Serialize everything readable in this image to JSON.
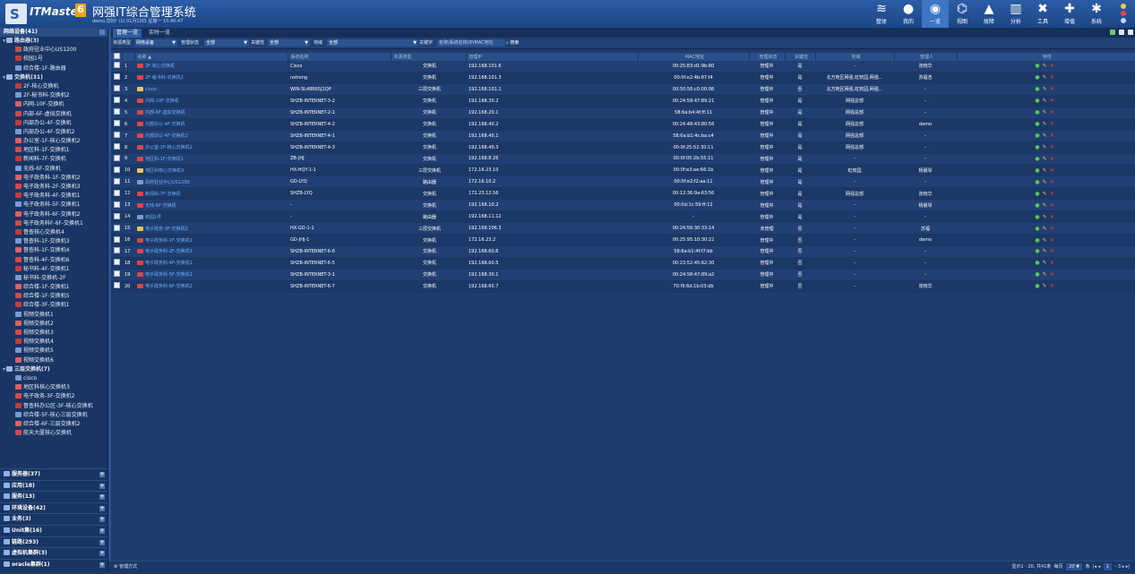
{
  "app": {
    "brand": "ITMaster",
    "brand_version": "6",
    "title": "网强IT综合管理系统",
    "user_line": "demo,您好! (1) 01月10日 星期一 15:40:47"
  },
  "nav": [
    {
      "label": "整体",
      "icon": "layers-icon",
      "glyph": "≋"
    },
    {
      "label": "我的",
      "icon": "user-icon",
      "glyph": "●"
    },
    {
      "label": "一览",
      "icon": "globe-icon",
      "glyph": "◉"
    },
    {
      "label": "视图",
      "icon": "topology-icon",
      "glyph": "⌬"
    },
    {
      "label": "故障",
      "icon": "alert-icon",
      "glyph": "▲"
    },
    {
      "label": "分析",
      "icon": "chart-icon",
      "glyph": "▥"
    },
    {
      "label": "工具",
      "icon": "tools-icon",
      "glyph": "✖"
    },
    {
      "label": "增值",
      "icon": "plus-icon",
      "glyph": "✚"
    },
    {
      "label": "系统",
      "icon": "gear-icon",
      "glyph": "✱"
    }
  ],
  "active_nav": 2,
  "sidebar": {
    "header": "网络设备(41)",
    "groups": [
      {
        "label": "路由器(3)",
        "items": [
          "政府驻业中心US1200",
          "校园1号",
          "综合楼-1F-路由器"
        ]
      },
      {
        "label": "交换机(31)",
        "items": [
          "2F-核心交换机",
          "2F-秘书科-交换机2",
          "内网-10F-交换机",
          "内部-6F-虚拟交换机",
          "内部办公-4F-交换机",
          "内部办公-4F-交换机2",
          "办公室-1F-核心交换机2",
          "地区科-1F-交换机1",
          "新闻科-7F-交换机",
          "无线-6F-交换机",
          "电子政务科-1F-交换机2",
          "电子政务科-2F-交换机3",
          "电子政务科-4F-交换机1",
          "电子政务科-5F-交换机1",
          "电子政务科-6F-交换机2",
          "电子政务科F-6F-交换机1",
          "督查核心交换机4",
          "督查科-1F-交换机3",
          "督查科-1F-交换机4",
          "督查科-4F-交换机6",
          "秘书科-4F-交换机1",
          "秘书科-交换机-2F",
          "综合楼-1F-交换机1",
          "综合楼-1F-交换机5",
          "综合楼-3F-交换机1",
          "视频交换机1",
          "视频交换机2",
          "视频交换机3",
          "视频交换机4",
          "视频交换机5",
          "视频交换机6"
        ]
      },
      {
        "label": "三层交换机(7)",
        "items": [
          "cisco",
          "地区科核心交换机3",
          "电子政务-3F-交换机2",
          "督查科办公区-3F-核心交换机",
          "综合楼-5F-核心三层交换机",
          "综合楼-6F-三层交换机2",
          "航天大厦核心交换机"
        ]
      }
    ],
    "categories": [
      "服务器(37)",
      "应用(18)",
      "服务(13)",
      "环境设备(42)",
      "业务(3)",
      "Unit集(16)",
      "链路(293)",
      "虚拟机集群(3)",
      "oracle集群(1)"
    ]
  },
  "tabs": {
    "mgmt": "管理一览",
    "realtime": "实时一览"
  },
  "filters": {
    "res_type_label": "资源类型",
    "res_type": "网络设备",
    "mgmt_state_label": "管理状态",
    "mgmt_state": "全部",
    "key_label": "关键性",
    "key": "全部",
    "region_label": "地域",
    "region": "全部",
    "keyword_label": "关键字",
    "keyword_placeholder": "名称/系统名称/IP/MAC地址",
    "search": "搜索"
  },
  "table": {
    "headers": [
      "",
      "",
      "名称 ▲",
      "系统名称",
      "资源类型",
      "管理IP",
      "MAC地址",
      "管理状态",
      "关键性",
      "地域",
      "管理人",
      "特性"
    ],
    "rows": [
      [
        "1",
        "2F-核心交换机",
        "Cisco",
        "交换机",
        "192.168.101.6",
        "00:25:83:d1:9b:80",
        "管理中",
        "是",
        "-",
        "张晓华"
      ],
      [
        "2",
        "2F-秘书科-交换机2",
        "nstrong",
        "交换机",
        "192.168.101.3",
        "00:0f:e2:4b:87:f4",
        "管理中",
        "是",
        "北方地区网强,虹软园,网强...",
        "苏福浩"
      ],
      [
        "3",
        "cisco",
        "WIN-SL48R65J1QP",
        "三层交换机",
        "192.168.101.1",
        "00:50:56:c0:00:08",
        "管理中",
        "否",
        "北方地区网强,虹软园,网强...",
        "-"
      ],
      [
        "4",
        "内网-10F-交换机",
        "SHZB-INTERNET-3-2",
        "交换机",
        "192.168.30.2",
        "00:24:58:47:89:21",
        "管理中",
        "是",
        "网强总部",
        "-"
      ],
      [
        "5",
        "内部-6F-虚拟交换机",
        "SHZB-INTERNET-2-1",
        "交换机",
        "192.168.20.1",
        "58:6a:b4:4f:ff:11",
        "管理中",
        "是",
        "网强总部",
        "-"
      ],
      [
        "6",
        "内部办公-4F-交换机",
        "SHZB-INTERNET-4-2",
        "交换机",
        "192.168.40.2",
        "00:24:48:43:80:56",
        "管理中",
        "是",
        "网强总部",
        "demo"
      ],
      [
        "7",
        "内部办公-4F-交换机2",
        "SHZB-INTERNET-4-1",
        "交换机",
        "192.168.40.1",
        "58:6a:b1:4c:ba:c4",
        "管理中",
        "是",
        "网强总部",
        "-"
      ],
      [
        "8",
        "办公室-1F-核心交换机2",
        "SHZB-INTERNET-4-3",
        "交换机",
        "192.168.40.3",
        "00:0f:25:52:30:11",
        "管理中",
        "是",
        "网强总部",
        "-"
      ],
      [
        "9",
        "地区科-1F-交换机1",
        "ZB-JHJ",
        "交换机",
        "192.168.8.26",
        "00:0f:05:2b:55:11",
        "管理中",
        "是",
        "-",
        "-"
      ],
      [
        "10",
        "地区科核心交换机3",
        "HX-HQY-1-1",
        "三层交换机",
        "172.16.23.10",
        "00:0f:e3:ee:66:1b",
        "管理中",
        "是",
        "虹软园",
        "杨晨琴"
      ],
      [
        "11",
        "政府驻业中心US1200",
        "GD-LYQ",
        "路由器",
        "172.16.10.2",
        "00:0f:e2:f2:aa:11",
        "管理中",
        "是",
        "-",
        "-"
      ],
      [
        "12",
        "新闻科-7F-交换机",
        "SHZB-LYQ",
        "交换机",
        "172.23.12.56",
        "00:12:36:9a:63:56",
        "管理中",
        "是",
        "网强总部",
        "张晓华"
      ],
      [
        "13",
        "无线-6F-交换机",
        "-",
        "交换机",
        "192.168.10.2",
        "00:0d:1c:59:ff:12",
        "管理中",
        "是",
        "-",
        "杨晨琴"
      ],
      [
        "14",
        "校园1号",
        "-",
        "路由器",
        "192.168.11.12",
        "-",
        "管理中",
        "是",
        "-",
        "-"
      ],
      [
        "15",
        "电子政务-3F-交换机2",
        "HX-GD-1-1",
        "三层交换机",
        "192.168.106.3",
        "00:24:56:30:33:14",
        "未管理",
        "否",
        "-",
        "苏福"
      ],
      [
        "16",
        "电子政务科-1F-交换机2",
        "GD-JHJ-1",
        "交换机",
        "172.16.23.2",
        "00:25:95:10:30:22",
        "管理中",
        "否",
        "-",
        "demo"
      ],
      [
        "17",
        "电子政务科-2F-交换机3",
        "SHZB-INTERNET-6-6",
        "交换机",
        "192.168.60.6",
        "58:6a:b1:4f:f7:bb",
        "管理中",
        "否",
        "-",
        "-"
      ],
      [
        "18",
        "电子政务科-4F-交换机1",
        "SHZB-INTERNET-6-5",
        "交换机",
        "192.168.60.5",
        "00:23:52:45:62:30",
        "管理中",
        "否",
        "-",
        "-"
      ],
      [
        "19",
        "电子政务科-5F-交换机1",
        "SHZB-INTERNET-3-1",
        "交换机",
        "192.168.30.1",
        "00:24:58:47:89:a2",
        "管理中",
        "否",
        "-",
        "-"
      ],
      [
        "20",
        "电子政务科-6F-交换机2",
        "SHZB-INTERNET-6-7",
        "交换机",
        "192.168.60.7",
        "70:f9:6d:1b:03:db",
        "管理中",
        "否",
        "-",
        "张晓华"
      ]
    ]
  },
  "footer": {
    "mgmt_mode": "管理方式",
    "range": "显示1 - 20, 共41条",
    "per_page_label": "每页",
    "per_page": "20",
    "per_page_unit": "条",
    "page": "1",
    "of_pages": "3"
  },
  "colors": {
    "accent": "#3e75c4",
    "link": "#6fb3ff",
    "ok": "#55c75a",
    "danger": "#ff4040"
  }
}
